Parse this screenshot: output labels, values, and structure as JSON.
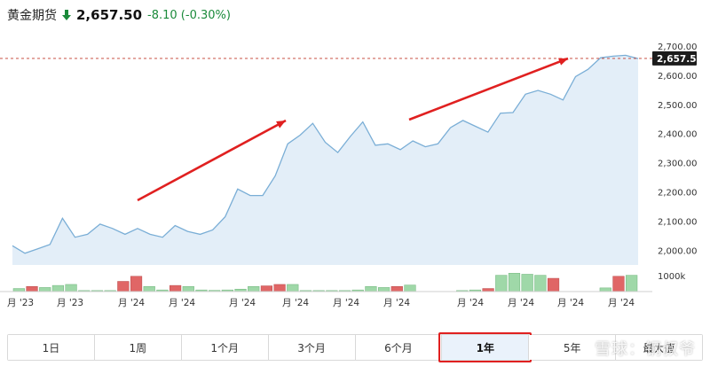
{
  "header": {
    "name": "黄金期货",
    "price": "2,657.50",
    "change": "-8.10 (-0.30%)",
    "change_color": "#1a8a3a"
  },
  "chart_data": {
    "type": "area",
    "ylim": [
      1950,
      2730
    ],
    "yticks": [
      2000,
      2100,
      2200,
      2300,
      2400,
      2500,
      2600,
      2700
    ],
    "ytick_labels": [
      "2,000.00",
      "2,100.00",
      "2,200.00",
      "2,300.00",
      "2,400.00",
      "2,500.00",
      "2,600.00",
      "2,700.00"
    ],
    "current_value": 2657.5,
    "current_label": "2,657.50",
    "x_labels": [
      "月 '23",
      "月 '23",
      "月 '24",
      "月 '24",
      "月 '24",
      "月 '24",
      "月 '24",
      "月 '24",
      "月 '24",
      "月 '24",
      "月 '24",
      "月 '24"
    ],
    "price_series": [
      2016,
      1990,
      2005,
      2020,
      2110,
      2045,
      2055,
      2090,
      2075,
      2055,
      2075,
      2055,
      2045,
      2085,
      2065,
      2055,
      2070,
      2115,
      2210,
      2188,
      2188,
      2255,
      2365,
      2395,
      2435,
      2370,
      2335,
      2390,
      2440,
      2360,
      2365,
      2345,
      2375,
      2355,
      2365,
      2420,
      2445,
      2425,
      2405,
      2470,
      2472,
      2535,
      2548,
      2535,
      2515,
      2595,
      2620,
      2660,
      2665,
      2668,
      2657
    ],
    "volume_label": "1000k",
    "volume_bars": [
      {
        "v": 0.15,
        "d": "up"
      },
      {
        "v": 0.25,
        "d": "down"
      },
      {
        "v": 0.2,
        "d": "up"
      },
      {
        "v": 0.3,
        "d": "up"
      },
      {
        "v": 0.35,
        "d": "up"
      },
      {
        "v": 0.05,
        "d": "up"
      },
      {
        "v": 0.05,
        "d": "up"
      },
      {
        "v": 0.05,
        "d": "up"
      },
      {
        "v": 0.5,
        "d": "down"
      },
      {
        "v": 0.75,
        "d": "down"
      },
      {
        "v": 0.25,
        "d": "up"
      },
      {
        "v": 0.08,
        "d": "up"
      },
      {
        "v": 0.3,
        "d": "down"
      },
      {
        "v": 0.25,
        "d": "up"
      },
      {
        "v": 0.08,
        "d": "up"
      },
      {
        "v": 0.06,
        "d": "up"
      },
      {
        "v": 0.08,
        "d": "up"
      },
      {
        "v": 0.12,
        "d": "up"
      },
      {
        "v": 0.25,
        "d": "up"
      },
      {
        "v": 0.28,
        "d": "down"
      },
      {
        "v": 0.35,
        "d": "down"
      },
      {
        "v": 0.35,
        "d": "up"
      },
      {
        "v": 0.05,
        "d": "up"
      },
      {
        "v": 0.05,
        "d": "up"
      },
      {
        "v": 0.05,
        "d": "up"
      },
      {
        "v": 0.05,
        "d": "up"
      },
      {
        "v": 0.08,
        "d": "up"
      },
      {
        "v": 0.25,
        "d": "up"
      },
      {
        "v": 0.2,
        "d": "up"
      },
      {
        "v": 0.25,
        "d": "down"
      },
      {
        "v": 0.32,
        "d": "up"
      },
      {
        "v": 0.0,
        "d": "up"
      },
      {
        "v": 0.0,
        "d": "up"
      },
      {
        "v": 0.0,
        "d": "up"
      },
      {
        "v": 0.05,
        "d": "up"
      },
      {
        "v": 0.08,
        "d": "up"
      },
      {
        "v": 0.15,
        "d": "down"
      },
      {
        "v": 0.8,
        "d": "up"
      },
      {
        "v": 0.9,
        "d": "up"
      },
      {
        "v": 0.85,
        "d": "up"
      },
      {
        "v": 0.8,
        "d": "up"
      },
      {
        "v": 0.65,
        "d": "down"
      },
      {
        "v": 0.0,
        "d": "up"
      },
      {
        "v": 0.0,
        "d": "up"
      },
      {
        "v": 0.0,
        "d": "up"
      },
      {
        "v": 0.18,
        "d": "up"
      },
      {
        "v": 0.75,
        "d": "down"
      },
      {
        "v": 0.8,
        "d": "up"
      }
    ],
    "colors": {
      "line": "#7aaed6",
      "fill": "#e3eef8",
      "up": "#9fd8a8",
      "down": "#e06666",
      "annotation": "#e02020"
    }
  },
  "ranges": [
    {
      "label": "1日",
      "active": false
    },
    {
      "label": "1周",
      "active": false
    },
    {
      "label": "1个月",
      "active": false
    },
    {
      "label": "3个月",
      "active": false
    },
    {
      "label": "6个月",
      "active": false
    },
    {
      "label": "1年",
      "active": true
    },
    {
      "label": "5年",
      "active": false
    },
    {
      "label": "最大值",
      "active": false
    }
  ],
  "watermark": "雪球：钢叔爷"
}
